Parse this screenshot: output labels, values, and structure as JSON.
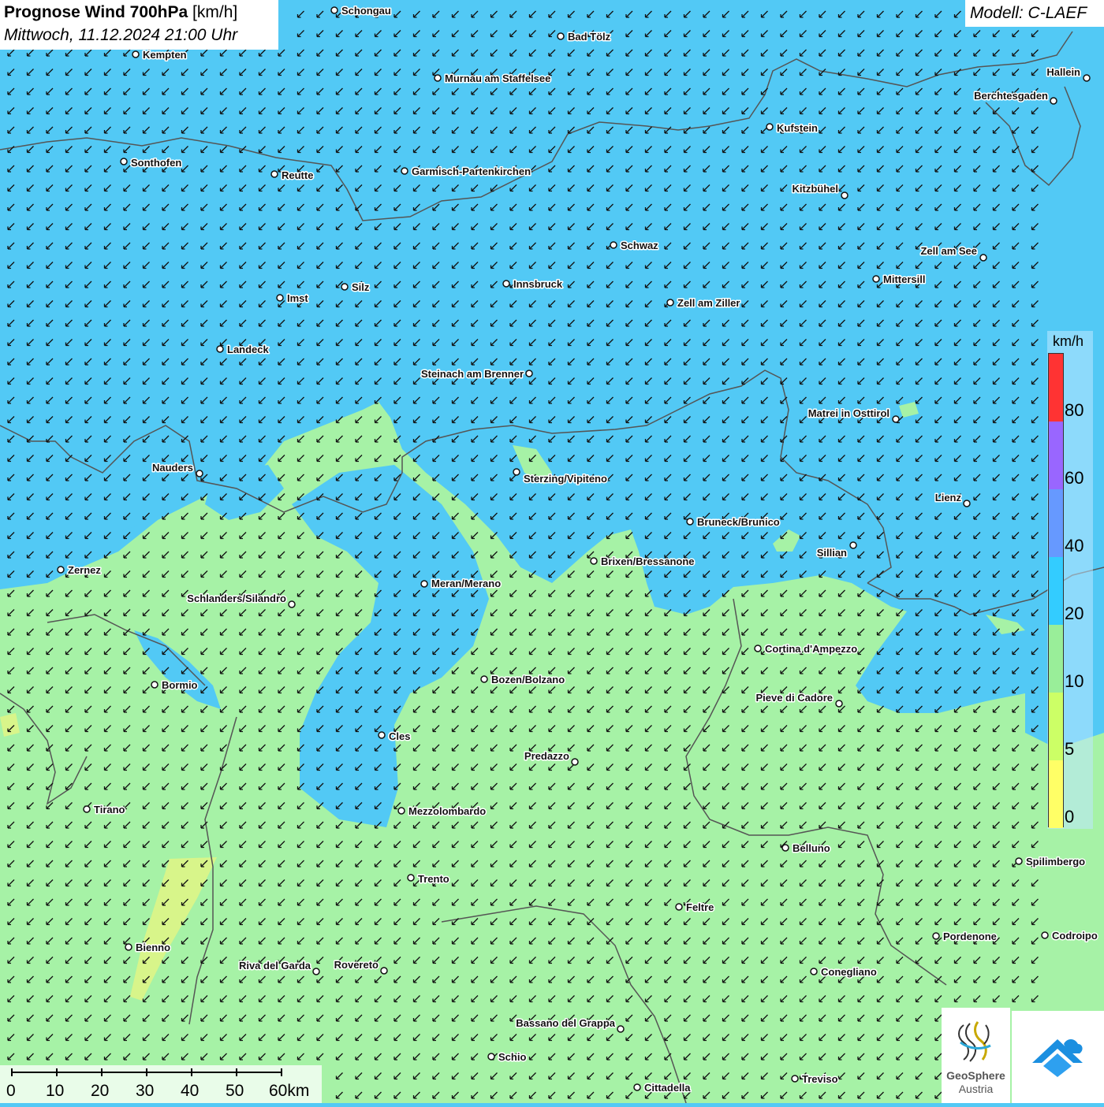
{
  "header": {
    "title_bold": "Prognose Wind 700hPa",
    "title_unit": "[km/h]",
    "datetime": "Mittwoch, 11.12.2024 21:00 Uhr"
  },
  "model": {
    "label": "Modell: C-LAEF"
  },
  "legend": {
    "unit": "km/h",
    "labels": [
      "80",
      "60",
      "40",
      "20",
      "10",
      "5",
      "0"
    ],
    "colors": {
      "band_0_5": "#ffff66",
      "band_5_10": "#ccff66",
      "band_10_20": "#99ee99",
      "band_20_40": "#33ccff",
      "band_40_60": "#6699ff",
      "band_60_80": "#9966ff",
      "band_80_plus": "#ff3333"
    }
  },
  "map_colors": {
    "wind_20_40": "#52c9f5",
    "wind_10_20": "#a6f2a6",
    "wind_5_10": "#d8f58a",
    "border": "#555555"
  },
  "scale_bar": {
    "labels": [
      "0",
      "10",
      "20",
      "30",
      "40",
      "50",
      "60km"
    ]
  },
  "wind": {
    "direction": "from north-east",
    "arrow_glyph": "↙"
  },
  "cities": [
    {
      "name": "Schongau"
    },
    {
      "name": "Bad Tölz"
    },
    {
      "name": "Kempten"
    },
    {
      "name": "Hallein"
    },
    {
      "name": "Murnau am Staffelsee"
    },
    {
      "name": "Berchtesgaden"
    },
    {
      "name": "Kufstein"
    },
    {
      "name": "Sonthofen"
    },
    {
      "name": "Reutte"
    },
    {
      "name": "Garmisch-Partenkirchen"
    },
    {
      "name": "Kitzbühel"
    },
    {
      "name": "Schwaz"
    },
    {
      "name": "Zell am See"
    },
    {
      "name": "Mittersill"
    },
    {
      "name": "Innsbruck"
    },
    {
      "name": "Silz"
    },
    {
      "name": "Imst"
    },
    {
      "name": "Zell am Ziller"
    },
    {
      "name": "Landeck"
    },
    {
      "name": "Steinach am Brenner"
    },
    {
      "name": "Matrei in Osttirol"
    },
    {
      "name": "Nauders"
    },
    {
      "name": "Sterzing/Vipiteno"
    },
    {
      "name": "Lienz"
    },
    {
      "name": "Bruneck/Brunico"
    },
    {
      "name": "Sillian"
    },
    {
      "name": "Brixen/Bressanone"
    },
    {
      "name": "Zernez"
    },
    {
      "name": "Meran/Merano"
    },
    {
      "name": "Schlanders/Silandro"
    },
    {
      "name": "Cortina d'Ampezzo"
    },
    {
      "name": "Bozen/Bolzano"
    },
    {
      "name": "Bormio"
    },
    {
      "name": "Pieve di Cadore"
    },
    {
      "name": "Cles"
    },
    {
      "name": "Predazzo"
    },
    {
      "name": "Tirano"
    },
    {
      "name": "Mezzolombardo"
    },
    {
      "name": "Belluno"
    },
    {
      "name": "Spilimbergo"
    },
    {
      "name": "Trento"
    },
    {
      "name": "Feltre"
    },
    {
      "name": "Pordenone"
    },
    {
      "name": "Codroipo"
    },
    {
      "name": "Bienno"
    },
    {
      "name": "Riva del Garda"
    },
    {
      "name": "Rovereto"
    },
    {
      "name": "Conegliano"
    },
    {
      "name": "Bassano del Grappa"
    },
    {
      "name": "Schio"
    },
    {
      "name": "Treviso"
    },
    {
      "name": "Cittadella"
    }
  ],
  "logos": {
    "geosphere_name": "GeoSphere",
    "geosphere_sub": "Austria"
  }
}
